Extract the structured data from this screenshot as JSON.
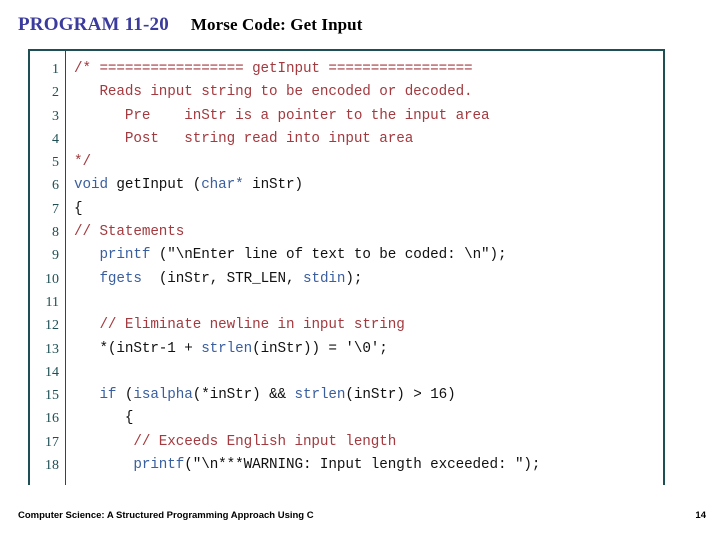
{
  "header": {
    "program_label": "PROGRAM 11-20",
    "program_title": "Morse Code: Get Input",
    "label_color": "#3b3b9e",
    "title_color": "#000000"
  },
  "codebox": {
    "border_color": "#1d4f54",
    "comment_color": "#a33a3f",
    "keyword_color": "#3a5f9f",
    "plain_color": "#111111",
    "line_numbers": [
      "1",
      "2",
      "3",
      "4",
      "5",
      "6",
      "7",
      "8",
      "9",
      "10",
      "11",
      "12",
      "13",
      "14",
      "15",
      "16",
      "17",
      "18"
    ],
    "lines": [
      {
        "n": "1",
        "segments": [
          {
            "t": "cmt",
            "s": "/* ================= getInput ================="
          }
        ]
      },
      {
        "n": "2",
        "segments": [
          {
            "t": "cmt",
            "s": "   Reads input string to be encoded or decoded."
          }
        ]
      },
      {
        "n": "3",
        "segments": [
          {
            "t": "cmt",
            "s": "      Pre    inStr is a pointer to the input area"
          }
        ]
      },
      {
        "n": "4",
        "segments": [
          {
            "t": "cmt",
            "s": "      Post   string read into input area"
          }
        ]
      },
      {
        "n": "5",
        "segments": [
          {
            "t": "cmt",
            "s": "*/"
          }
        ]
      },
      {
        "n": "6",
        "segments": [
          {
            "t": "kw",
            "s": "void"
          },
          {
            "t": "plain",
            "s": " getInput ("
          },
          {
            "t": "kw",
            "s": "char*"
          },
          {
            "t": "plain",
            "s": " inStr)"
          }
        ]
      },
      {
        "n": "7",
        "segments": [
          {
            "t": "plain",
            "s": "{"
          }
        ]
      },
      {
        "n": "8",
        "segments": [
          {
            "t": "cmt",
            "s": "// Statements"
          }
        ]
      },
      {
        "n": "9",
        "segments": [
          {
            "t": "plain",
            "s": "   "
          },
          {
            "t": "kw",
            "s": "printf"
          },
          {
            "t": "plain",
            "s": " (\"\\nEnter line of text to be coded: \\n\");"
          }
        ]
      },
      {
        "n": "10",
        "segments": [
          {
            "t": "plain",
            "s": "   "
          },
          {
            "t": "kw",
            "s": "fgets"
          },
          {
            "t": "plain",
            "s": "  (inStr, STR_LEN, "
          },
          {
            "t": "kw",
            "s": "stdin"
          },
          {
            "t": "plain",
            "s": ");"
          }
        ]
      },
      {
        "n": "11",
        "segments": [
          {
            "t": "plain",
            "s": ""
          }
        ]
      },
      {
        "n": "12",
        "segments": [
          {
            "t": "plain",
            "s": "   "
          },
          {
            "t": "cmt",
            "s": "// Eliminate newline in input string"
          }
        ]
      },
      {
        "n": "13",
        "segments": [
          {
            "t": "plain",
            "s": "   *(inStr-1 + "
          },
          {
            "t": "kw",
            "s": "strlen"
          },
          {
            "t": "plain",
            "s": "(inStr)) = '\\0';"
          }
        ]
      },
      {
        "n": "14",
        "segments": [
          {
            "t": "plain",
            "s": ""
          }
        ]
      },
      {
        "n": "15",
        "segments": [
          {
            "t": "plain",
            "s": "   "
          },
          {
            "t": "kw",
            "s": "if"
          },
          {
            "t": "plain",
            "s": " ("
          },
          {
            "t": "kw",
            "s": "isalpha"
          },
          {
            "t": "plain",
            "s": "(*inStr) && "
          },
          {
            "t": "kw",
            "s": "strlen"
          },
          {
            "t": "plain",
            "s": "(inStr) > 16)"
          }
        ]
      },
      {
        "n": "16",
        "segments": [
          {
            "t": "plain",
            "s": "      {"
          }
        ]
      },
      {
        "n": "17",
        "segments": [
          {
            "t": "plain",
            "s": "       "
          },
          {
            "t": "cmt",
            "s": "// Exceeds English input length"
          }
        ]
      },
      {
        "n": "18",
        "segments": [
          {
            "t": "plain",
            "s": "       "
          },
          {
            "t": "kw",
            "s": "printf"
          },
          {
            "t": "plain",
            "s": "(\"\\n***WARNING: Input length exceeded: \");"
          }
        ]
      }
    ]
  },
  "footer": {
    "book_title": "Computer Science: A Structured Programming Approach Using C",
    "page_number": "14"
  }
}
